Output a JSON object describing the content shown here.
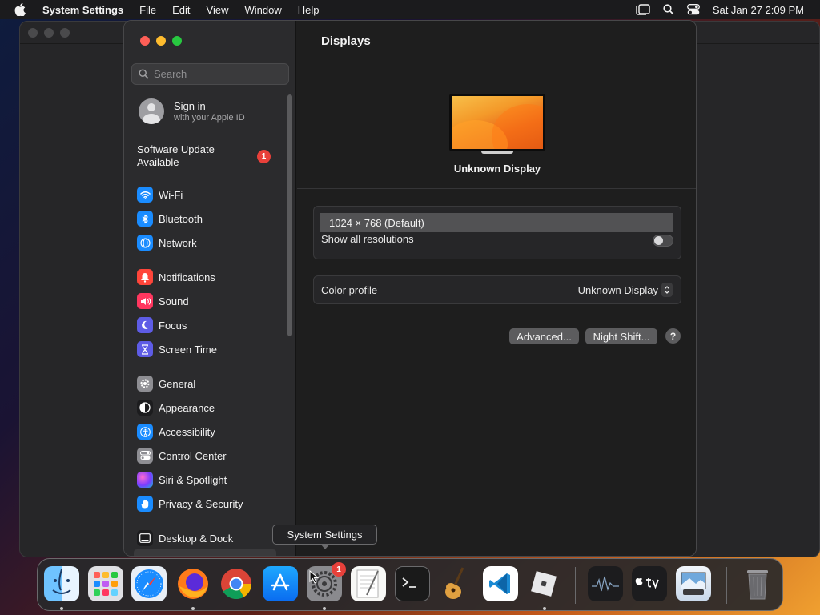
{
  "menubar": {
    "app_name": "System Settings",
    "items": [
      "File",
      "Edit",
      "View",
      "Window",
      "Help"
    ],
    "clock": "Sat Jan 27  2:09 PM"
  },
  "sidebar": {
    "search_placeholder": "Search",
    "signin": {
      "title": "Sign in",
      "subtitle": "with your Apple ID"
    },
    "update": {
      "label": "Software Update Available",
      "badge": "1"
    },
    "items": [
      {
        "label": "Wi-Fi",
        "icon": "wifi-icon",
        "color": "#1a8cff"
      },
      {
        "label": "Bluetooth",
        "icon": "bluetooth-icon",
        "color": "#1a8cff"
      },
      {
        "label": "Network",
        "icon": "globe-icon",
        "color": "#1a8cff"
      },
      {
        "label": "Notifications",
        "icon": "bell-icon",
        "color": "#ff453a"
      },
      {
        "label": "Sound",
        "icon": "speaker-icon",
        "color": "#ff375f"
      },
      {
        "label": "Focus",
        "icon": "moon-icon",
        "color": "#5e5ce6"
      },
      {
        "label": "Screen Time",
        "icon": "hourglass-icon",
        "color": "#5e5ce6"
      },
      {
        "label": "General",
        "icon": "gear-icon",
        "color": "#8e8e93"
      },
      {
        "label": "Appearance",
        "icon": "appearance-icon",
        "color": "#1c1c1e"
      },
      {
        "label": "Accessibility",
        "icon": "accessibility-icon",
        "color": "#1a8cff"
      },
      {
        "label": "Control Center",
        "icon": "control-center-icon",
        "color": "#8e8e93"
      },
      {
        "label": "Siri & Spotlight",
        "icon": "siri-icon",
        "color": "#bf5af2"
      },
      {
        "label": "Privacy & Security",
        "icon": "hand-icon",
        "color": "#1a8cff"
      },
      {
        "label": "Desktop & Dock",
        "icon": "dock-icon",
        "color": "#1c1c1e"
      }
    ]
  },
  "content": {
    "title": "Displays",
    "display_name": "Unknown Display",
    "resolution": "1024 × 768 (Default)",
    "show_all_label": "Show all resolutions",
    "show_all_enabled": false,
    "color_profile_label": "Color profile",
    "color_profile_value": "Unknown Display",
    "advanced_label": "Advanced...",
    "night_shift_label": "Night Shift...",
    "help_label": "?"
  },
  "tooltip": "System Settings",
  "dock": {
    "badge": "1",
    "apps": [
      {
        "name": "Finder",
        "icon": "finder-icon",
        "running": true
      },
      {
        "name": "Launchpad",
        "icon": "launchpad-icon",
        "running": false
      },
      {
        "name": "Safari",
        "icon": "safari-icon",
        "running": false
      },
      {
        "name": "Firefox",
        "icon": "firefox-icon",
        "running": true
      },
      {
        "name": "Chrome",
        "icon": "chrome-icon",
        "running": false
      },
      {
        "name": "App Store",
        "icon": "app-store-icon",
        "running": false
      },
      {
        "name": "System Settings",
        "icon": "system-settings-icon",
        "running": true
      },
      {
        "name": "TextEdit",
        "icon": "textedit-icon",
        "running": false
      },
      {
        "name": "Terminal",
        "icon": "terminal-icon",
        "running": false
      },
      {
        "name": "GarageBand",
        "icon": "guitar-icon",
        "running": false
      },
      {
        "name": "VS Code",
        "icon": "vscode-icon",
        "running": false
      },
      {
        "name": "Roblox",
        "icon": "roblox-icon",
        "running": true
      },
      {
        "name": "Activity Monitor",
        "icon": "activity-monitor-icon",
        "running": false
      },
      {
        "name": "Apple TV",
        "icon": "apple-tv-icon",
        "running": false
      },
      {
        "name": "Preview",
        "icon": "preview-icon",
        "running": false
      },
      {
        "name": "Trash",
        "icon": "trash-icon",
        "running": false
      }
    ]
  }
}
